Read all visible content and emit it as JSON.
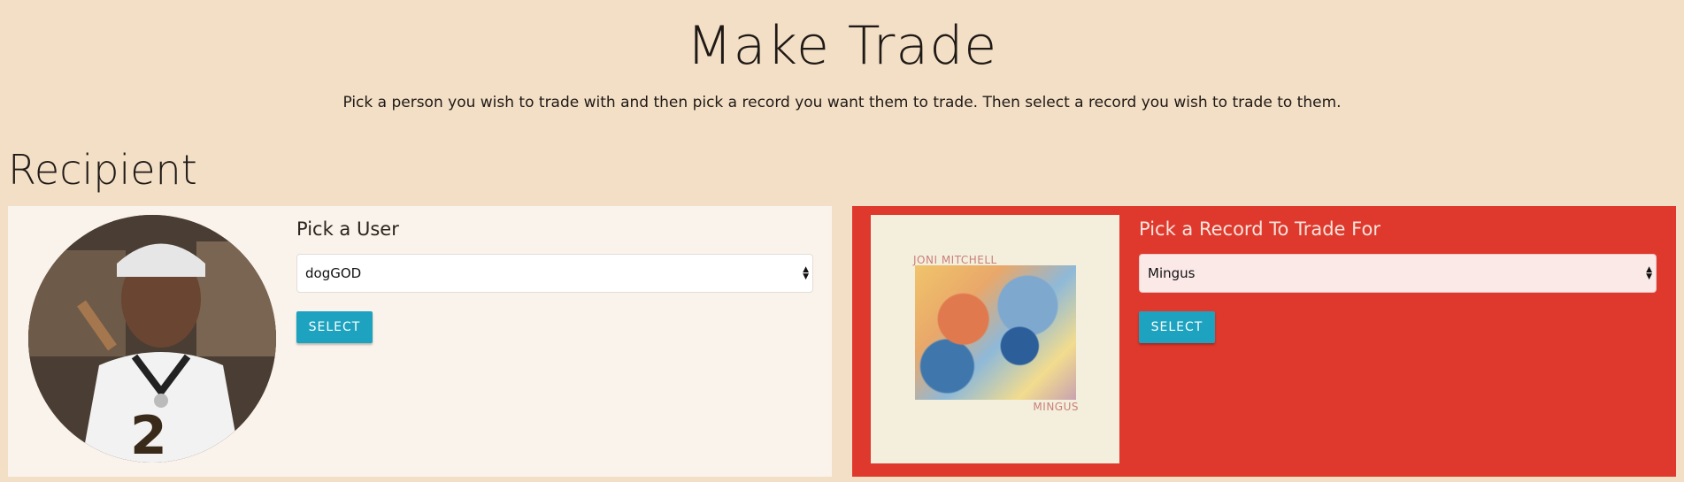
{
  "header": {
    "title": "Make Trade",
    "subtitle": "Pick a person you wish to trade with and then pick a record you want them to trade. Then select a record you wish to trade to them."
  },
  "section": {
    "heading": "Recipient"
  },
  "user_panel": {
    "label": "Pick a User",
    "selected_user": "dogGOD",
    "button_label": "SELECT",
    "avatar_icon": "user-avatar-photo"
  },
  "record_panel": {
    "label": "Pick a Record To Trade For",
    "selected_record": "Mingus",
    "button_label": "SELECT",
    "cover_artist": "JONI MITCHELL",
    "cover_title": "MINGUS"
  },
  "colors": {
    "background": "#f3dfc6",
    "user_panel_bg": "#faf3eb",
    "record_panel_bg": "#df382c",
    "button": "#1da2bf"
  }
}
